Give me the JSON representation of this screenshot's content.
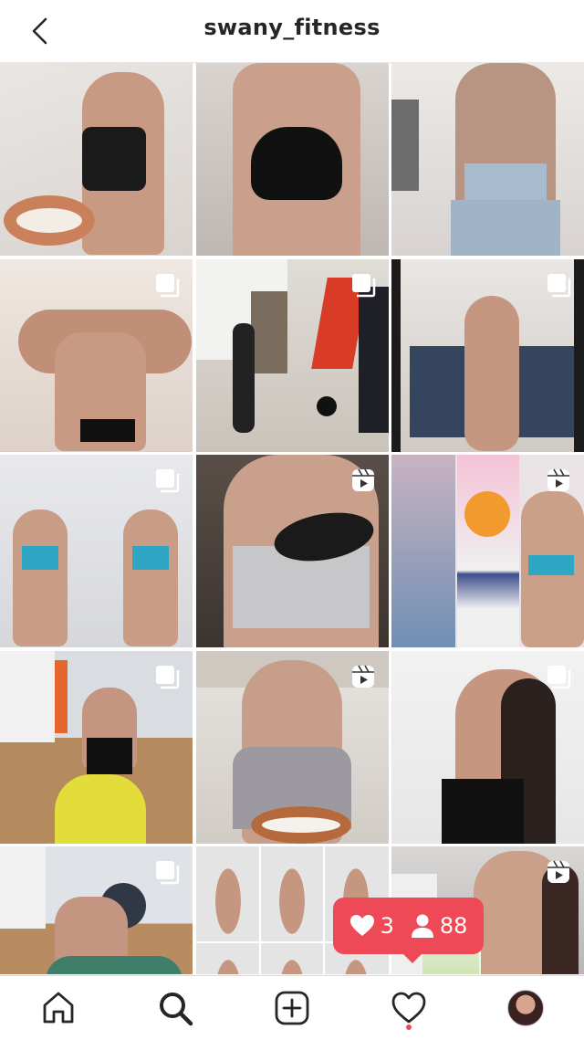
{
  "header": {
    "title": "swany_fitness",
    "back_icon": "chevron-left-icon"
  },
  "grid": {
    "tiles": [
      {
        "id": 1,
        "overlay": "none"
      },
      {
        "id": 2,
        "overlay": "none"
      },
      {
        "id": 3,
        "overlay": "none"
      },
      {
        "id": 4,
        "overlay": "carousel-icon"
      },
      {
        "id": 5,
        "overlay": "carousel-icon"
      },
      {
        "id": 6,
        "overlay": "carousel-icon"
      },
      {
        "id": 7,
        "overlay": "carousel-icon"
      },
      {
        "id": 8,
        "overlay": "reels-icon"
      },
      {
        "id": 9,
        "overlay": "reels-icon"
      },
      {
        "id": 10,
        "overlay": "carousel-icon"
      },
      {
        "id": 11,
        "overlay": "reels-icon"
      },
      {
        "id": 12,
        "overlay": "carousel-icon"
      },
      {
        "id": 13,
        "overlay": "carousel-icon"
      },
      {
        "id": 14,
        "overlay": "none"
      },
      {
        "id": 15,
        "overlay": "reels-icon"
      }
    ]
  },
  "notification": {
    "likes": "3",
    "followers": "88",
    "color": "#ed4956"
  },
  "bottom_nav": {
    "items": [
      "home-icon",
      "search-icon",
      "new-post-icon",
      "activity-heart-icon",
      "profile-avatar"
    ],
    "activity_dot_color": "#ed4956"
  }
}
